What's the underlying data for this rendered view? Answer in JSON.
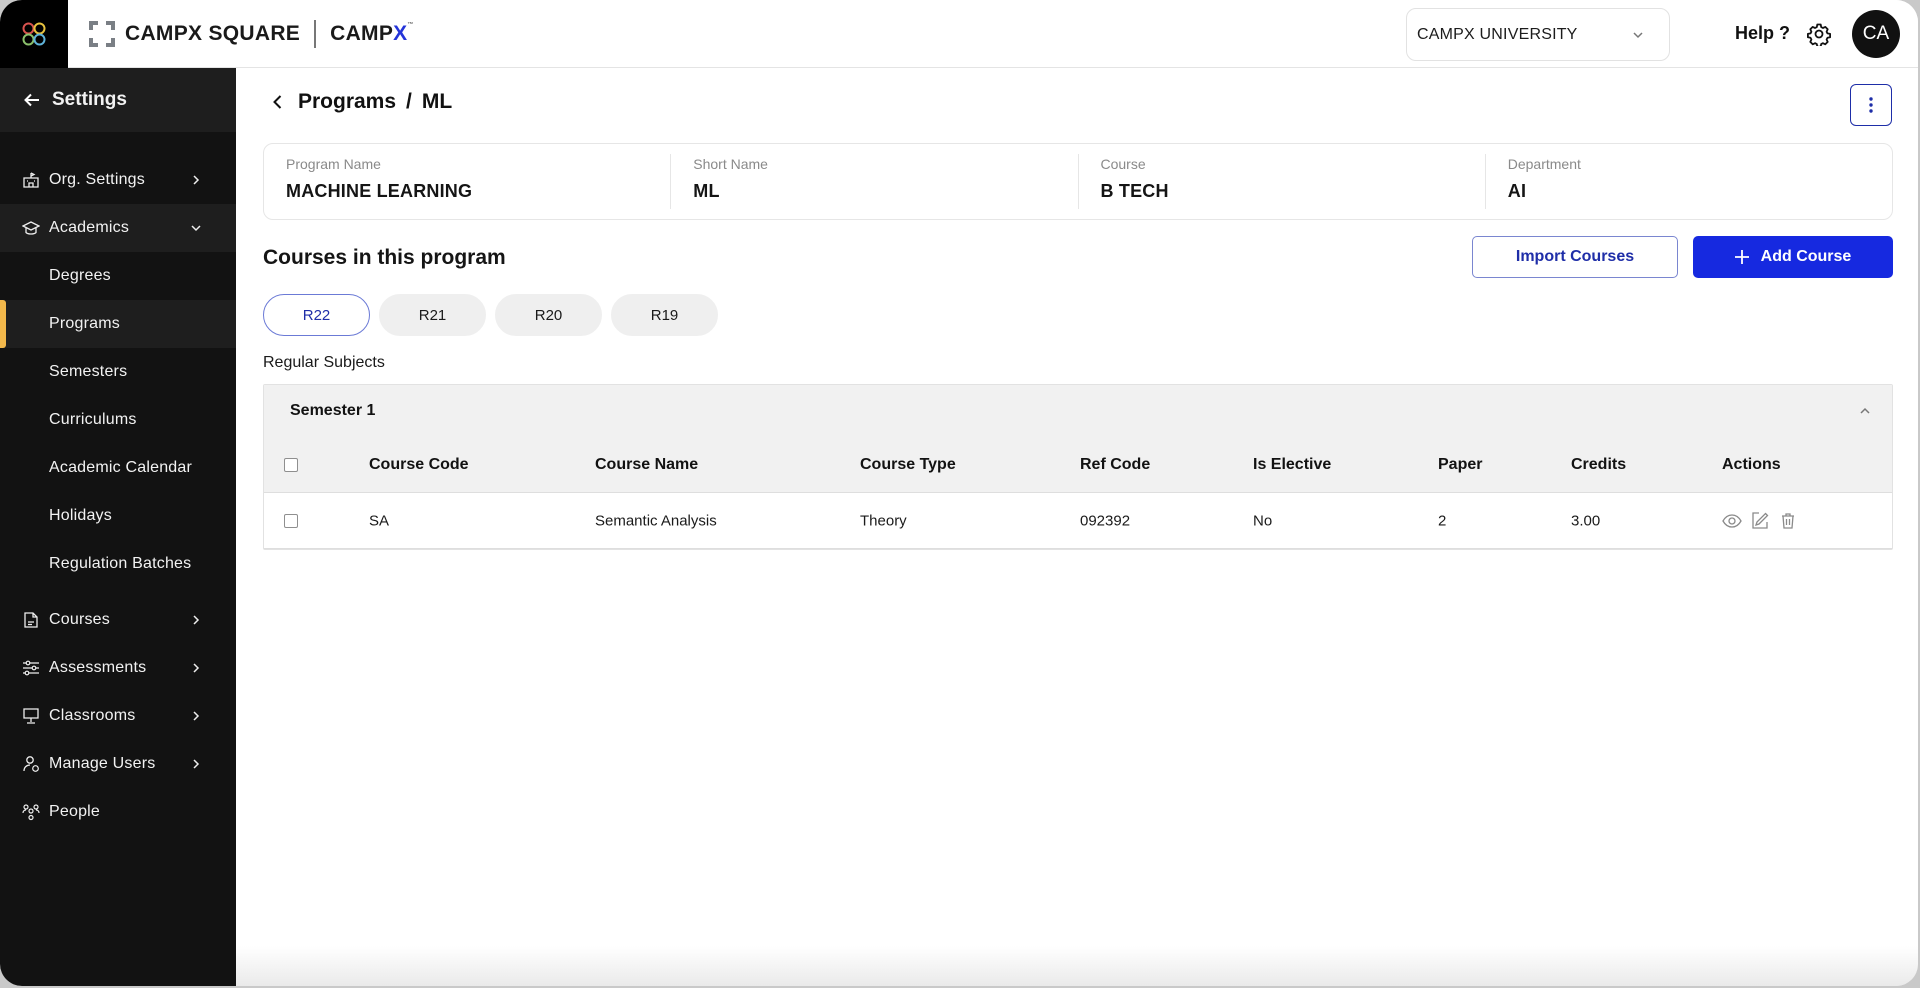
{
  "topbar": {
    "launcher_icon": "app-grid-icon",
    "brand_name": "CAMPX SQUARE",
    "brand_secondary": "CAMP",
    "brand_secondary_x": "X",
    "org_select_value": "CAMPX UNIVERSITY",
    "help_label": "Help ?",
    "avatar_initials": "CA",
    "accent_color": "#1629e0"
  },
  "sidebar": {
    "header_label": "Settings",
    "items": [
      {
        "label": "Org. Settings",
        "icon": "building-icon",
        "expandable": true,
        "expanded": false
      },
      {
        "label": "Academics",
        "icon": "graduation-cap-icon",
        "expandable": true,
        "expanded": true,
        "children": [
          {
            "label": "Degrees",
            "active": false
          },
          {
            "label": "Programs",
            "active": true
          },
          {
            "label": "Semesters",
            "active": false
          },
          {
            "label": "Curriculums",
            "active": false
          },
          {
            "label": "Academic Calendar",
            "active": false
          },
          {
            "label": "Holidays",
            "active": false
          },
          {
            "label": "Regulation Batches",
            "active": false
          }
        ]
      },
      {
        "label": "Courses",
        "icon": "document-icon",
        "expandable": true,
        "expanded": false
      },
      {
        "label": "Assessments",
        "icon": "sliders-icon",
        "expandable": true,
        "expanded": false
      },
      {
        "label": "Classrooms",
        "icon": "presentation-board-icon",
        "expandable": true,
        "expanded": false
      },
      {
        "label": "Manage Users",
        "icon": "user-settings-icon",
        "expandable": true,
        "expanded": false
      },
      {
        "label": "People",
        "icon": "people-icon",
        "expandable": false,
        "expanded": false
      }
    ],
    "active_indicator_color": "#f2b84b"
  },
  "main": {
    "breadcrumb": {
      "parent": "Programs",
      "separator": "/",
      "current": "ML"
    },
    "info": [
      {
        "label": "Program Name",
        "value": "MACHINE LEARNING"
      },
      {
        "label": "Short Name",
        "value": "ML"
      },
      {
        "label": "Course",
        "value": "B TECH"
      },
      {
        "label": "Department",
        "value": "AI"
      }
    ],
    "section_title": "Courses in this program",
    "import_button": "Import Courses",
    "add_button": "Add Course",
    "regulation_tabs": [
      {
        "label": "R22",
        "active": true
      },
      {
        "label": "R21",
        "active": false
      },
      {
        "label": "R20",
        "active": false
      },
      {
        "label": "R19",
        "active": false
      }
    ],
    "subsection_title": "Regular Subjects",
    "semesters": [
      {
        "title": "Semester 1",
        "expanded": true,
        "columns": [
          "Course Code",
          "Course Name",
          "Course Type",
          "Ref Code",
          "Is Elective",
          "Paper",
          "Credits",
          "Actions"
        ],
        "rows": [
          {
            "course_code": "SA",
            "course_name": "Semantic Analysis",
            "course_type": "Theory",
            "ref_code": "092392",
            "is_elective": "No",
            "paper": "2",
            "credits": "3.00",
            "actions": [
              "view-icon",
              "edit-icon",
              "delete-icon"
            ]
          }
        ]
      }
    ]
  }
}
